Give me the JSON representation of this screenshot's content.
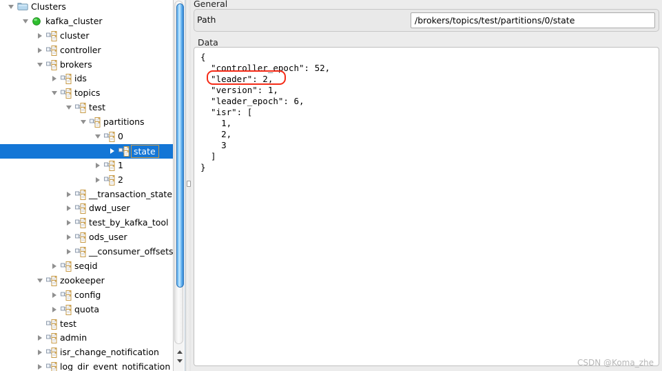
{
  "app": {
    "watermark": "CSDN @Koma_zhe"
  },
  "tree": {
    "scrollbar_name": "tree-vertical-scrollbar",
    "nodes": [
      {
        "label": "Clusters",
        "depth": 0,
        "twisty": "expanded",
        "icon": "folder-icon",
        "selected": false
      },
      {
        "label": "kafka_cluster",
        "depth": 1,
        "twisty": "expanded",
        "icon": "green-status-icon",
        "selected": false
      },
      {
        "label": "cluster",
        "depth": 2,
        "twisty": "collapsed",
        "icon": "znode-icon",
        "selected": false
      },
      {
        "label": "controller",
        "depth": 2,
        "twisty": "collapsed",
        "icon": "znode-icon",
        "selected": false
      },
      {
        "label": "brokers",
        "depth": 2,
        "twisty": "expanded",
        "icon": "znode-icon",
        "selected": false
      },
      {
        "label": "ids",
        "depth": 3,
        "twisty": "collapsed",
        "icon": "znode-icon",
        "selected": false
      },
      {
        "label": "topics",
        "depth": 3,
        "twisty": "expanded",
        "icon": "znode-icon",
        "selected": false
      },
      {
        "label": "test",
        "depth": 4,
        "twisty": "expanded",
        "icon": "znode-icon",
        "selected": false
      },
      {
        "label": "partitions",
        "depth": 5,
        "twisty": "expanded",
        "icon": "znode-icon",
        "selected": false
      },
      {
        "label": "0",
        "depth": 6,
        "twisty": "expanded",
        "icon": "znode-icon",
        "selected": false
      },
      {
        "label": "state",
        "depth": 7,
        "twisty": "collapsed",
        "icon": "znode-icon",
        "selected": true
      },
      {
        "label": "1",
        "depth": 6,
        "twisty": "collapsed",
        "icon": "znode-icon",
        "selected": false
      },
      {
        "label": "2",
        "depth": 6,
        "twisty": "collapsed",
        "icon": "znode-icon",
        "selected": false
      },
      {
        "label": "__transaction_state",
        "depth": 4,
        "twisty": "collapsed",
        "icon": "znode-icon",
        "selected": false
      },
      {
        "label": "dwd_user",
        "depth": 4,
        "twisty": "collapsed",
        "icon": "znode-icon",
        "selected": false
      },
      {
        "label": "test_by_kafka_tool",
        "depth": 4,
        "twisty": "collapsed",
        "icon": "znode-icon",
        "selected": false
      },
      {
        "label": "ods_user",
        "depth": 4,
        "twisty": "collapsed",
        "icon": "znode-icon",
        "selected": false
      },
      {
        "label": "__consumer_offsets",
        "depth": 4,
        "twisty": "collapsed",
        "icon": "znode-icon",
        "selected": false
      },
      {
        "label": "seqid",
        "depth": 3,
        "twisty": "collapsed",
        "icon": "znode-icon",
        "selected": false
      },
      {
        "label": "zookeeper",
        "depth": 2,
        "twisty": "expanded",
        "icon": "znode-icon",
        "selected": false
      },
      {
        "label": "config",
        "depth": 3,
        "twisty": "collapsed",
        "icon": "znode-icon",
        "selected": false
      },
      {
        "label": "quota",
        "depth": 3,
        "twisty": "collapsed",
        "icon": "znode-icon",
        "selected": false
      },
      {
        "label": "test",
        "depth": 2,
        "twisty": "none",
        "icon": "znode-icon",
        "selected": false
      },
      {
        "label": "admin",
        "depth": 2,
        "twisty": "collapsed",
        "icon": "znode-icon",
        "selected": false
      },
      {
        "label": "isr_change_notification",
        "depth": 2,
        "twisty": "collapsed",
        "icon": "znode-icon",
        "selected": false
      },
      {
        "label": "log_dir_event_notification",
        "depth": 2,
        "twisty": "collapsed",
        "icon": "znode-icon",
        "selected": false
      }
    ]
  },
  "detail": {
    "general_group_label": "General",
    "path_label": "Path",
    "path_value": "/brokers/topics/test/partitions/0/state",
    "data_group_label": "Data",
    "data_value": "{\n  \"controller_epoch\": 52,\n  \"leader\": 2,\n  \"version\": 1,\n  \"leader_epoch\": 6,\n  \"isr\": [\n    1,\n    2,\n    3\n  ]\n}",
    "annotation": {
      "name": "leader-highlight",
      "color": "#f52a16",
      "target_text": "\"leader\": 2,"
    }
  }
}
